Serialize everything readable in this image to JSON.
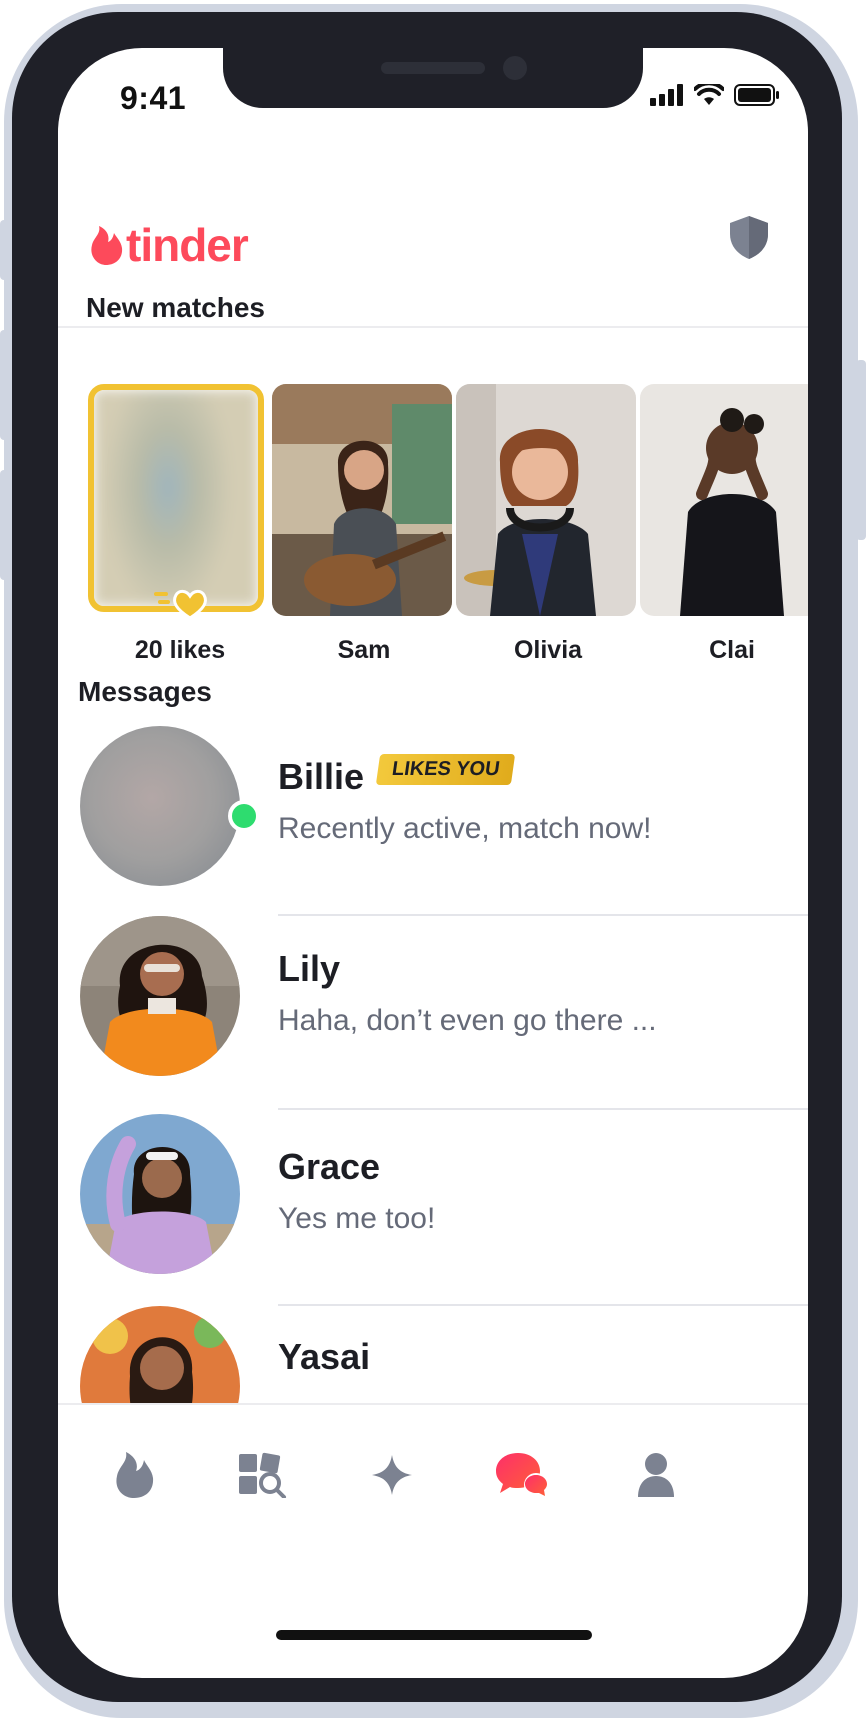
{
  "status_bar": {
    "time": "9:41"
  },
  "header": {
    "logo_text": "tinder",
    "brand_color": "#fd4a5b"
  },
  "new_matches": {
    "title": "New matches",
    "items": [
      {
        "label": "20 likes",
        "kind": "likes-card"
      },
      {
        "label": "Sam",
        "kind": "profile"
      },
      {
        "label": "Olivia",
        "kind": "profile"
      },
      {
        "label": "Clai",
        "kind": "profile"
      }
    ]
  },
  "messages": {
    "title": "Messages",
    "items": [
      {
        "name": "Billie",
        "badge": "LIKES YOU",
        "preview": "Recently active, match now!",
        "online": true
      },
      {
        "name": "Lily",
        "preview": "Haha, don’t even go there ..."
      },
      {
        "name": "Grace",
        "preview": "Yes me too!"
      },
      {
        "name": "Yasai",
        "preview": ""
      }
    ]
  },
  "tab_bar": {
    "items": [
      {
        "icon": "flame-icon",
        "active": false
      },
      {
        "icon": "explore-icon",
        "active": false
      },
      {
        "icon": "sparkle-icon",
        "active": false
      },
      {
        "icon": "chat-icon",
        "active": true
      },
      {
        "icon": "profile-icon",
        "active": false
      }
    ],
    "active_color": "#fd4a5b",
    "inactive_color": "#7c8291"
  }
}
